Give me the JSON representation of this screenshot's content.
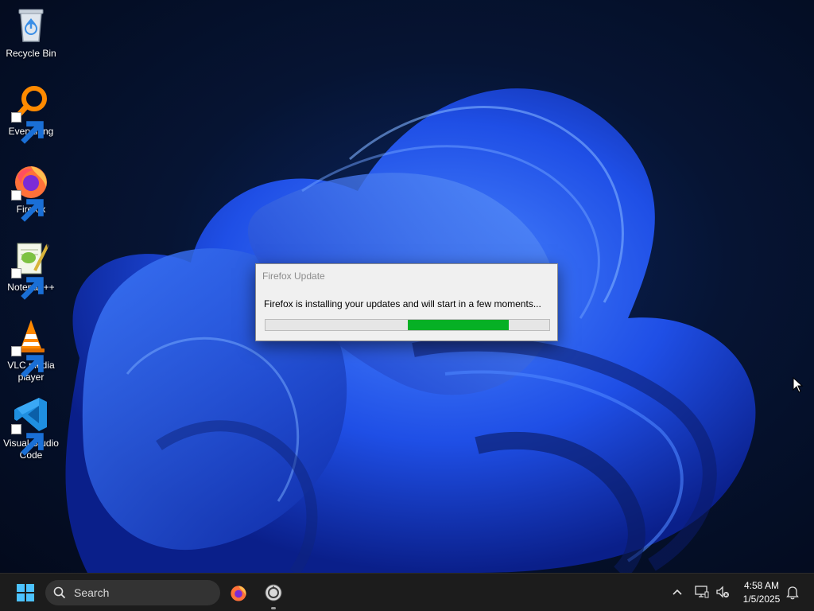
{
  "desktop": {
    "icons": [
      {
        "label": "Recycle Bin",
        "icon": "recycle-bin-icon"
      },
      {
        "label": "Everything",
        "icon": "everything-search-icon"
      },
      {
        "label": "Firefox",
        "icon": "firefox-icon"
      },
      {
        "label": "Notepad++",
        "icon": "notepad-plus-plus-icon"
      },
      {
        "label": "VLC media player",
        "icon": "vlc-cone-icon"
      },
      {
        "label": "Visual Studio Code",
        "icon": "vscode-icon"
      }
    ]
  },
  "dialog": {
    "title": "Firefox Update",
    "message": "Firefox is installing your updates and will start in a few moments...",
    "progress_indicator": {
      "start_fraction": 0.5,
      "end_fraction": 0.855,
      "color": "#06b025"
    }
  },
  "taskbar": {
    "start_icon": "windows-logo-icon",
    "search_label": "Search",
    "pinned_apps": [
      {
        "name": "Firefox",
        "icon": "firefox-icon"
      },
      {
        "name": "Firefox updater",
        "icon": "updater-icon",
        "running": true
      }
    ],
    "tray": {
      "time": "4:58 AM",
      "date": "1/5/2025"
    }
  },
  "colors": {
    "accent_blue": "#1f5bff",
    "taskbar_bg": "#1c1c1c",
    "dialog_bg": "#f0f0f0"
  }
}
